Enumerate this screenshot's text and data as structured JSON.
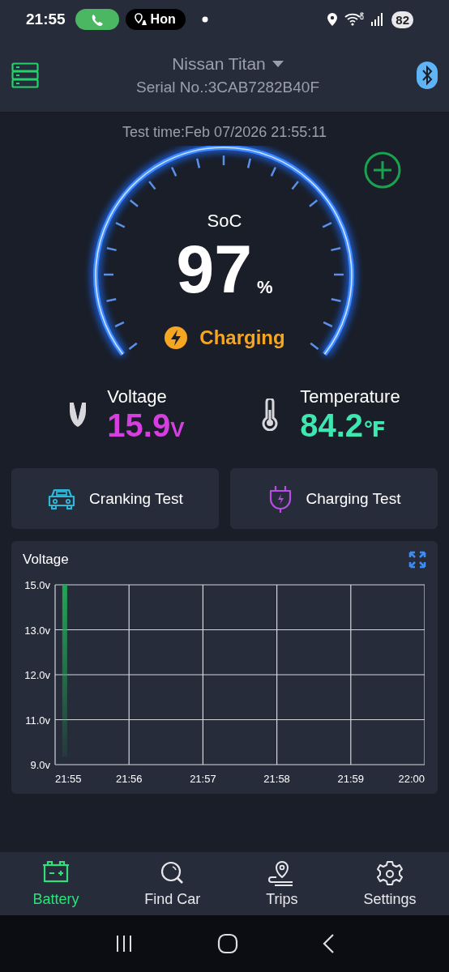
{
  "status_bar": {
    "time": "21:55",
    "chip_text": "Hon",
    "battery": "82"
  },
  "header": {
    "vehicle": "Nissan Titan",
    "serial": "Serial No.:3CAB7282B40F"
  },
  "test_time": "Test time:Feb 07/2026 21:55:11",
  "gauge": {
    "label": "SoC",
    "value": "97",
    "unit": "%",
    "status": "Charging"
  },
  "readings": [
    {
      "kind": "voltage",
      "label": "Voltage",
      "value": "15.9",
      "unit": "V",
      "color": "#d63ee0"
    },
    {
      "kind": "temperature",
      "label": "Temperature",
      "value": "84.2",
      "unit": "℉",
      "color": "#3ee6b0"
    }
  ],
  "actions": [
    {
      "kind": "car",
      "label": "Cranking Test"
    },
    {
      "kind": "plug",
      "label": "Charging Test"
    }
  ],
  "chart": {
    "title": "Voltage",
    "y_labels": [
      "15.0v",
      "13.0v",
      "12.0v",
      "11.0v",
      "9.0v"
    ],
    "x_labels": [
      "21:55",
      "21:56",
      "21:57",
      "21:58",
      "21:59",
      "22:00"
    ]
  },
  "nav": [
    {
      "kind": "battery",
      "label": "Battery",
      "selected": true
    },
    {
      "kind": "find",
      "label": "Find Car",
      "selected": false
    },
    {
      "kind": "trips",
      "label": "Trips",
      "selected": false
    },
    {
      "kind": "settings",
      "label": "Settings",
      "selected": false
    }
  ]
}
